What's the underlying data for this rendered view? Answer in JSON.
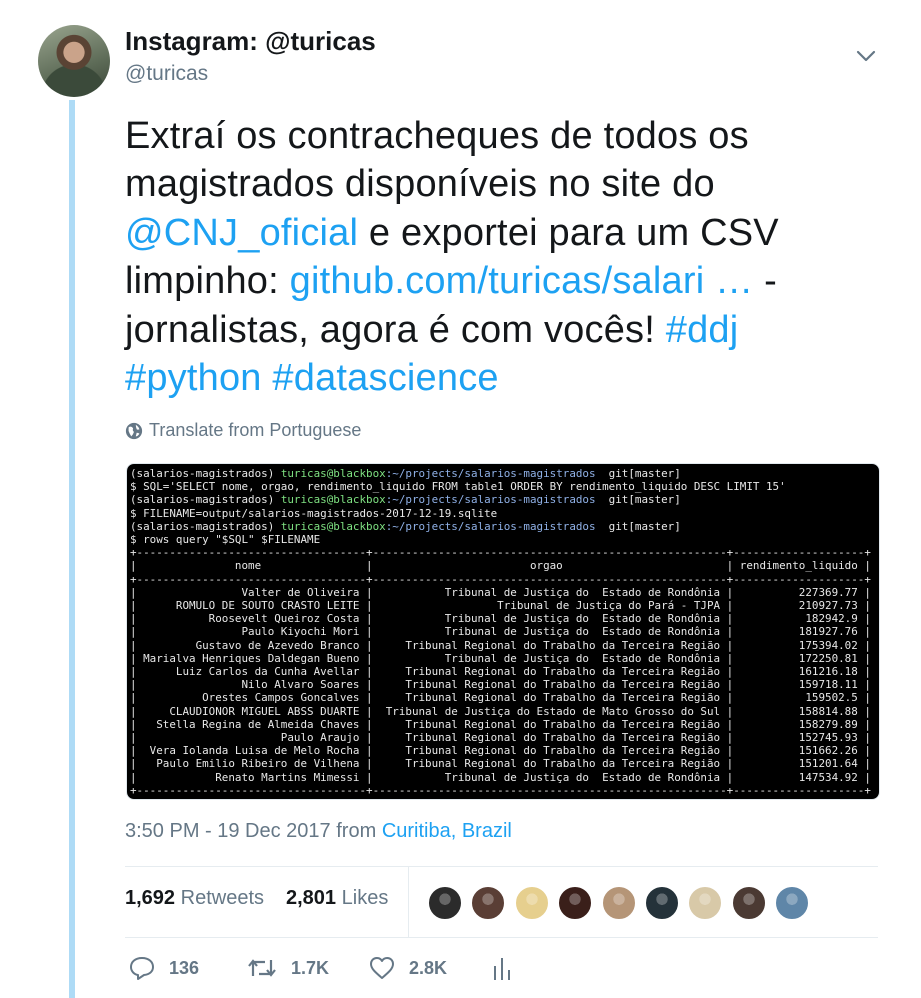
{
  "author": {
    "display_name": "Instagram: @turicas",
    "handle": "@turicas"
  },
  "tweet": {
    "text_parts": [
      "Extraí os contracheques de todos os magistrados disponíveis no site do ",
      "@CNJ_oficial",
      " e exportei para um CSV limpinho: ",
      "github.com/turicas/salari …",
      " - jornalistas, agora é com vocês! ",
      "#ddj",
      "#python",
      "#datascience"
    ],
    "translate_label": "Translate from Portuguese",
    "timestamp": "3:50 PM - 19 Dec 2017",
    "from_label": "from",
    "location": "Curitiba, Brazil"
  },
  "terminal": {
    "prompts": [
      {
        "env": "(salarios-magistrados)",
        "user": "turicas@blackbox",
        "path": ":~/projects/salarios-magistrados",
        "git": "  git[master]",
        "cmd": "$ SQL='SELECT nome, orgao, rendimento_liquido FROM table1 ORDER BY rendimento_liquido DESC LIMIT 15'"
      },
      {
        "env": "(salarios-magistrados)",
        "user": "turicas@blackbox",
        "path": ":~/projects/salarios-magistrados",
        "git": "  git[master]",
        "cmd": "$ FILENAME=output/salarios-magistrados-2017-12-19.sqlite"
      },
      {
        "env": "(salarios-magistrados)",
        "user": "turicas@blackbox",
        "path": ":~/projects/salarios-magistrados",
        "git": "  git[master]",
        "cmd": "$ rows query \"$SQL\" $FILENAME"
      }
    ],
    "columns": [
      "nome",
      "orgao",
      "rendimento_liquido"
    ],
    "rows": [
      [
        "Valter de Oliveira",
        "Tribunal de Justiça do  Estado de Rondônia",
        "227369.77"
      ],
      [
        "ROMULO DE SOUTO CRASTO LEITE",
        "Tribunal de Justiça do Pará - TJPA",
        "210927.73"
      ],
      [
        "Roosevelt Queiroz Costa",
        "Tribunal de Justiça do  Estado de Rondônia",
        "182942.9"
      ],
      [
        "Paulo Kiyochi Mori",
        "Tribunal de Justiça do  Estado de Rondônia",
        "181927.76"
      ],
      [
        "Gustavo de Azevedo Branco",
        "Tribunal Regional do Trabalho da Terceira Região",
        "175394.02"
      ],
      [
        "Marialva Henriques Daldegan Bueno",
        "Tribunal de Justiça do  Estado de Rondônia",
        "172250.81"
      ],
      [
        "Luiz Carlos da Cunha Avellar",
        "Tribunal Regional do Trabalho da Terceira Região",
        "161216.18"
      ],
      [
        "Nilo Alvaro Soares",
        "Tribunal Regional do Trabalho da Terceira Região",
        "159718.11"
      ],
      [
        "Orestes Campos Goncalves",
        "Tribunal Regional do Trabalho da Terceira Região",
        "159502.5"
      ],
      [
        "CLAUDIONOR MIGUEL ABSS DUARTE",
        "Tribunal de Justiça do Estado de Mato Grosso do Sul",
        "158814.88"
      ],
      [
        "Stella Regina de Almeida Chaves",
        "Tribunal Regional do Trabalho da Terceira Região",
        "158279.89"
      ],
      [
        "Paulo Araujo",
        "Tribunal Regional do Trabalho da Terceira Região",
        "152745.93"
      ],
      [
        "Vera Iolanda Luisa de Melo Rocha",
        "Tribunal Regional do Trabalho da Terceira Região",
        "151662.26"
      ],
      [
        "Paulo Emilio Ribeiro de Vilhena",
        "Tribunal Regional do Trabalho da Terceira Região",
        "151201.64"
      ],
      [
        "Renato Martins Mimessi",
        "Tribunal de Justiça do  Estado de Rondônia",
        "147534.92"
      ]
    ]
  },
  "stats": {
    "retweets_count": "1,692",
    "retweets_label": "Retweets",
    "likes_count": "2,801",
    "likes_label": "Likes"
  },
  "likers": [
    {
      "icon": "liker-avatar-1",
      "color": "#2b2b2b"
    },
    {
      "icon": "liker-avatar-2",
      "color": "#5a3e35"
    },
    {
      "icon": "liker-avatar-3",
      "color": "#e6cf8e"
    },
    {
      "icon": "liker-avatar-4",
      "color": "#3a1f1a"
    },
    {
      "icon": "liker-avatar-5",
      "color": "#b59577"
    },
    {
      "icon": "liker-avatar-6",
      "color": "#24323a"
    },
    {
      "icon": "liker-avatar-7",
      "color": "#d8c9a8"
    },
    {
      "icon": "liker-avatar-8",
      "color": "#4b3a33"
    },
    {
      "icon": "liker-avatar-9",
      "color": "#5f86a8"
    }
  ],
  "actions": {
    "reply_count": "136",
    "retweet_count": "1.7K",
    "like_count": "2.8K"
  },
  "colors": {
    "link": "#1da1f2",
    "secondary_text": "#657786",
    "thread_line": "#aedbf6"
  }
}
